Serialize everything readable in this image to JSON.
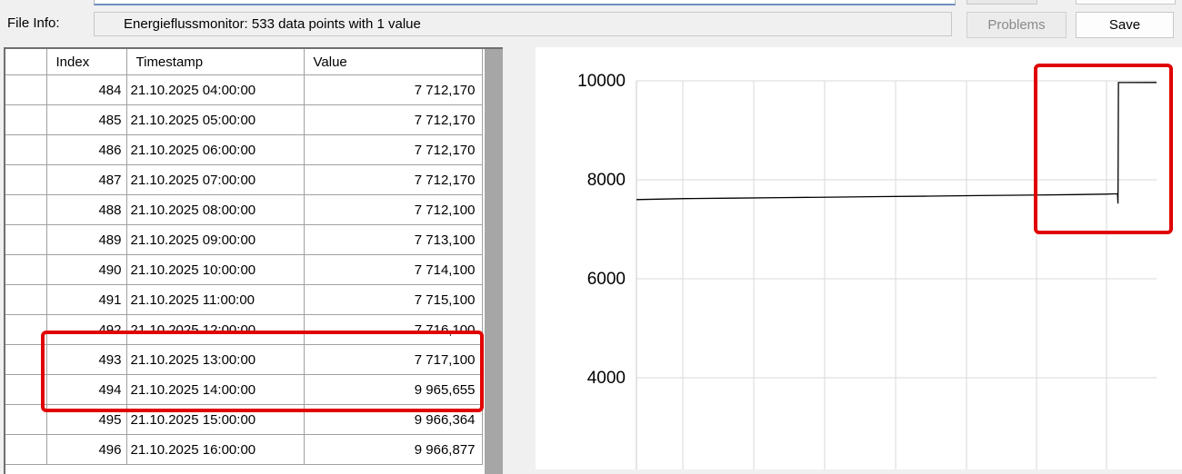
{
  "file_info": {
    "label": "File Info:",
    "value": "Energieflussmonitor: 533 data points with 1 value"
  },
  "buttons": {
    "problems": "Problems",
    "save": "Save"
  },
  "table": {
    "columns": [
      "Index",
      "Timestamp",
      "Value"
    ],
    "rows": [
      {
        "index": "484",
        "timestamp": "21.10.2025 04:00:00",
        "value": "7 712,170"
      },
      {
        "index": "485",
        "timestamp": "21.10.2025 05:00:00",
        "value": "7 712,170"
      },
      {
        "index": "486",
        "timestamp": "21.10.2025 06:00:00",
        "value": "7 712,170"
      },
      {
        "index": "487",
        "timestamp": "21.10.2025 07:00:00",
        "value": "7 712,170"
      },
      {
        "index": "488",
        "timestamp": "21.10.2025 08:00:00",
        "value": "7 712,100"
      },
      {
        "index": "489",
        "timestamp": "21.10.2025 09:00:00",
        "value": "7 713,100"
      },
      {
        "index": "490",
        "timestamp": "21.10.2025 10:00:00",
        "value": "7 714,100"
      },
      {
        "index": "491",
        "timestamp": "21.10.2025 11:00:00",
        "value": "7 715,100"
      },
      {
        "index": "492",
        "timestamp": "21.10.2025 12:00:00",
        "value": "7 716,100"
      },
      {
        "index": "493",
        "timestamp": "21.10.2025 13:00:00",
        "value": "7 717,100"
      },
      {
        "index": "494",
        "timestamp": "21.10.2025 14:00:00",
        "value": "9 965,655"
      },
      {
        "index": "495",
        "timestamp": "21.10.2025 15:00:00",
        "value": "9 966,364"
      },
      {
        "index": "496",
        "timestamp": "21.10.2025 16:00:00",
        "value": "9 966,877"
      }
    ]
  },
  "chart_data": {
    "type": "line",
    "title": "",
    "xlabel": "",
    "ylabel": "",
    "grid": true,
    "yticks": [
      10000,
      8000,
      6000,
      4000
    ],
    "series": [
      {
        "color": "#000000",
        "x": [
          0,
          50,
          100,
          150,
          200,
          250,
          300,
          350,
          400,
          450,
          480,
          493,
          493.5,
          494,
          500,
          533
        ],
        "y": [
          7600,
          7620,
          7630,
          7640,
          7650,
          7660,
          7670,
          7680,
          7690,
          7700,
          7710,
          7717,
          7520,
          9965,
          9966,
          9967
        ]
      }
    ]
  },
  "highlight_color": "#e00000"
}
